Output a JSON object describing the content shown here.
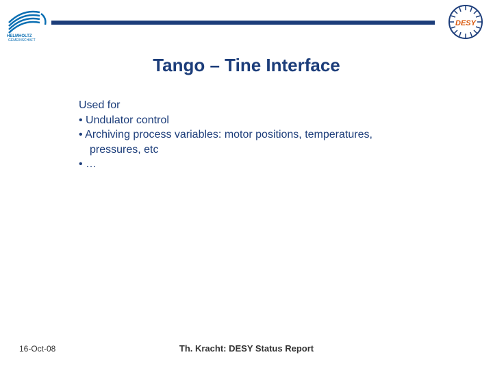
{
  "title": "Tango – Tine Interface",
  "content": {
    "heading": "Used for",
    "bullets": [
      "Undulator control",
      "Archiving process variables: motor positions, temperatures, pressures, etc",
      "…"
    ]
  },
  "footer": {
    "date": "16-Oct-08",
    "center": "Th. Kracht: DESY Status Report"
  },
  "logos": {
    "left_name": "helmholtz-logo",
    "right_name": "desy-logo"
  }
}
